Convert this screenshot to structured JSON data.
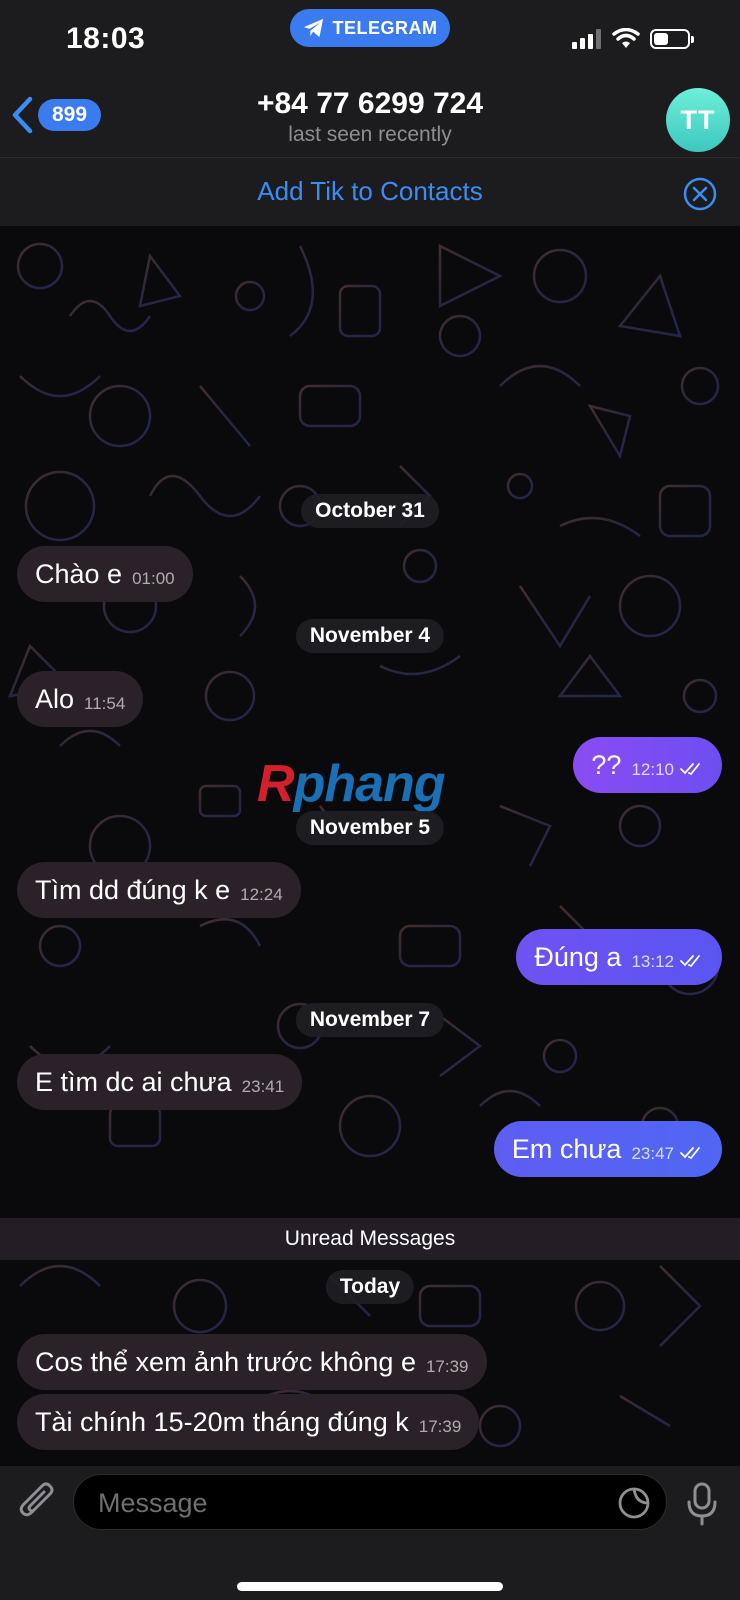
{
  "status_bar": {
    "time": "18:03",
    "app_pill": "TELEGRAM"
  },
  "header": {
    "back_count": "899",
    "title": "+84 77 6299 724",
    "subtitle": "last seen recently",
    "avatar_initials": "TT"
  },
  "banner": {
    "add_contact": "Add Tik to Contacts"
  },
  "watermark": {
    "prefix": "R",
    "rest": "phang"
  },
  "dates": [
    "October 31",
    "November 4",
    "November 5",
    "November 7",
    "Today"
  ],
  "messages": [
    {
      "dir": "in",
      "text": "Chào e",
      "time": "01:00"
    },
    {
      "dir": "in",
      "text": "Alo",
      "time": "11:54"
    },
    {
      "dir": "out",
      "text": "??",
      "time": "12:10",
      "read": true
    },
    {
      "dir": "in",
      "text": "Tìm dd đúng k e",
      "time": "12:24"
    },
    {
      "dir": "out",
      "text": "Đúng a",
      "time": "13:12",
      "read": true
    },
    {
      "dir": "in",
      "text": "E tìm dc ai chưa",
      "time": "23:41"
    },
    {
      "dir": "out",
      "text": "Em chưa",
      "time": "23:47",
      "read": true
    },
    {
      "dir": "in",
      "text": "Cos thể xem ảnh trước không e",
      "time": "17:39"
    },
    {
      "dir": "in",
      "text": "Tài chính 15-20m tháng đúng k",
      "time": "17:39"
    }
  ],
  "unread_label": "Unread Messages",
  "composer": {
    "placeholder": "Message"
  },
  "colors": {
    "accent": "#3a7bf0",
    "link": "#3a8df5",
    "incoming_bubble": "#2a2228",
    "outgoing_bubble_start": "#8a4cf3",
    "outgoing_bubble_end": "#4f67f3",
    "avatar": "#4fd8c8"
  },
  "icons": [
    "telegram-plane-icon",
    "signal-icon",
    "wifi-icon",
    "battery-icon",
    "back-chevron-icon",
    "close-circle-icon",
    "double-check-icon",
    "paperclip-icon",
    "sticker-icon",
    "microphone-icon"
  ]
}
